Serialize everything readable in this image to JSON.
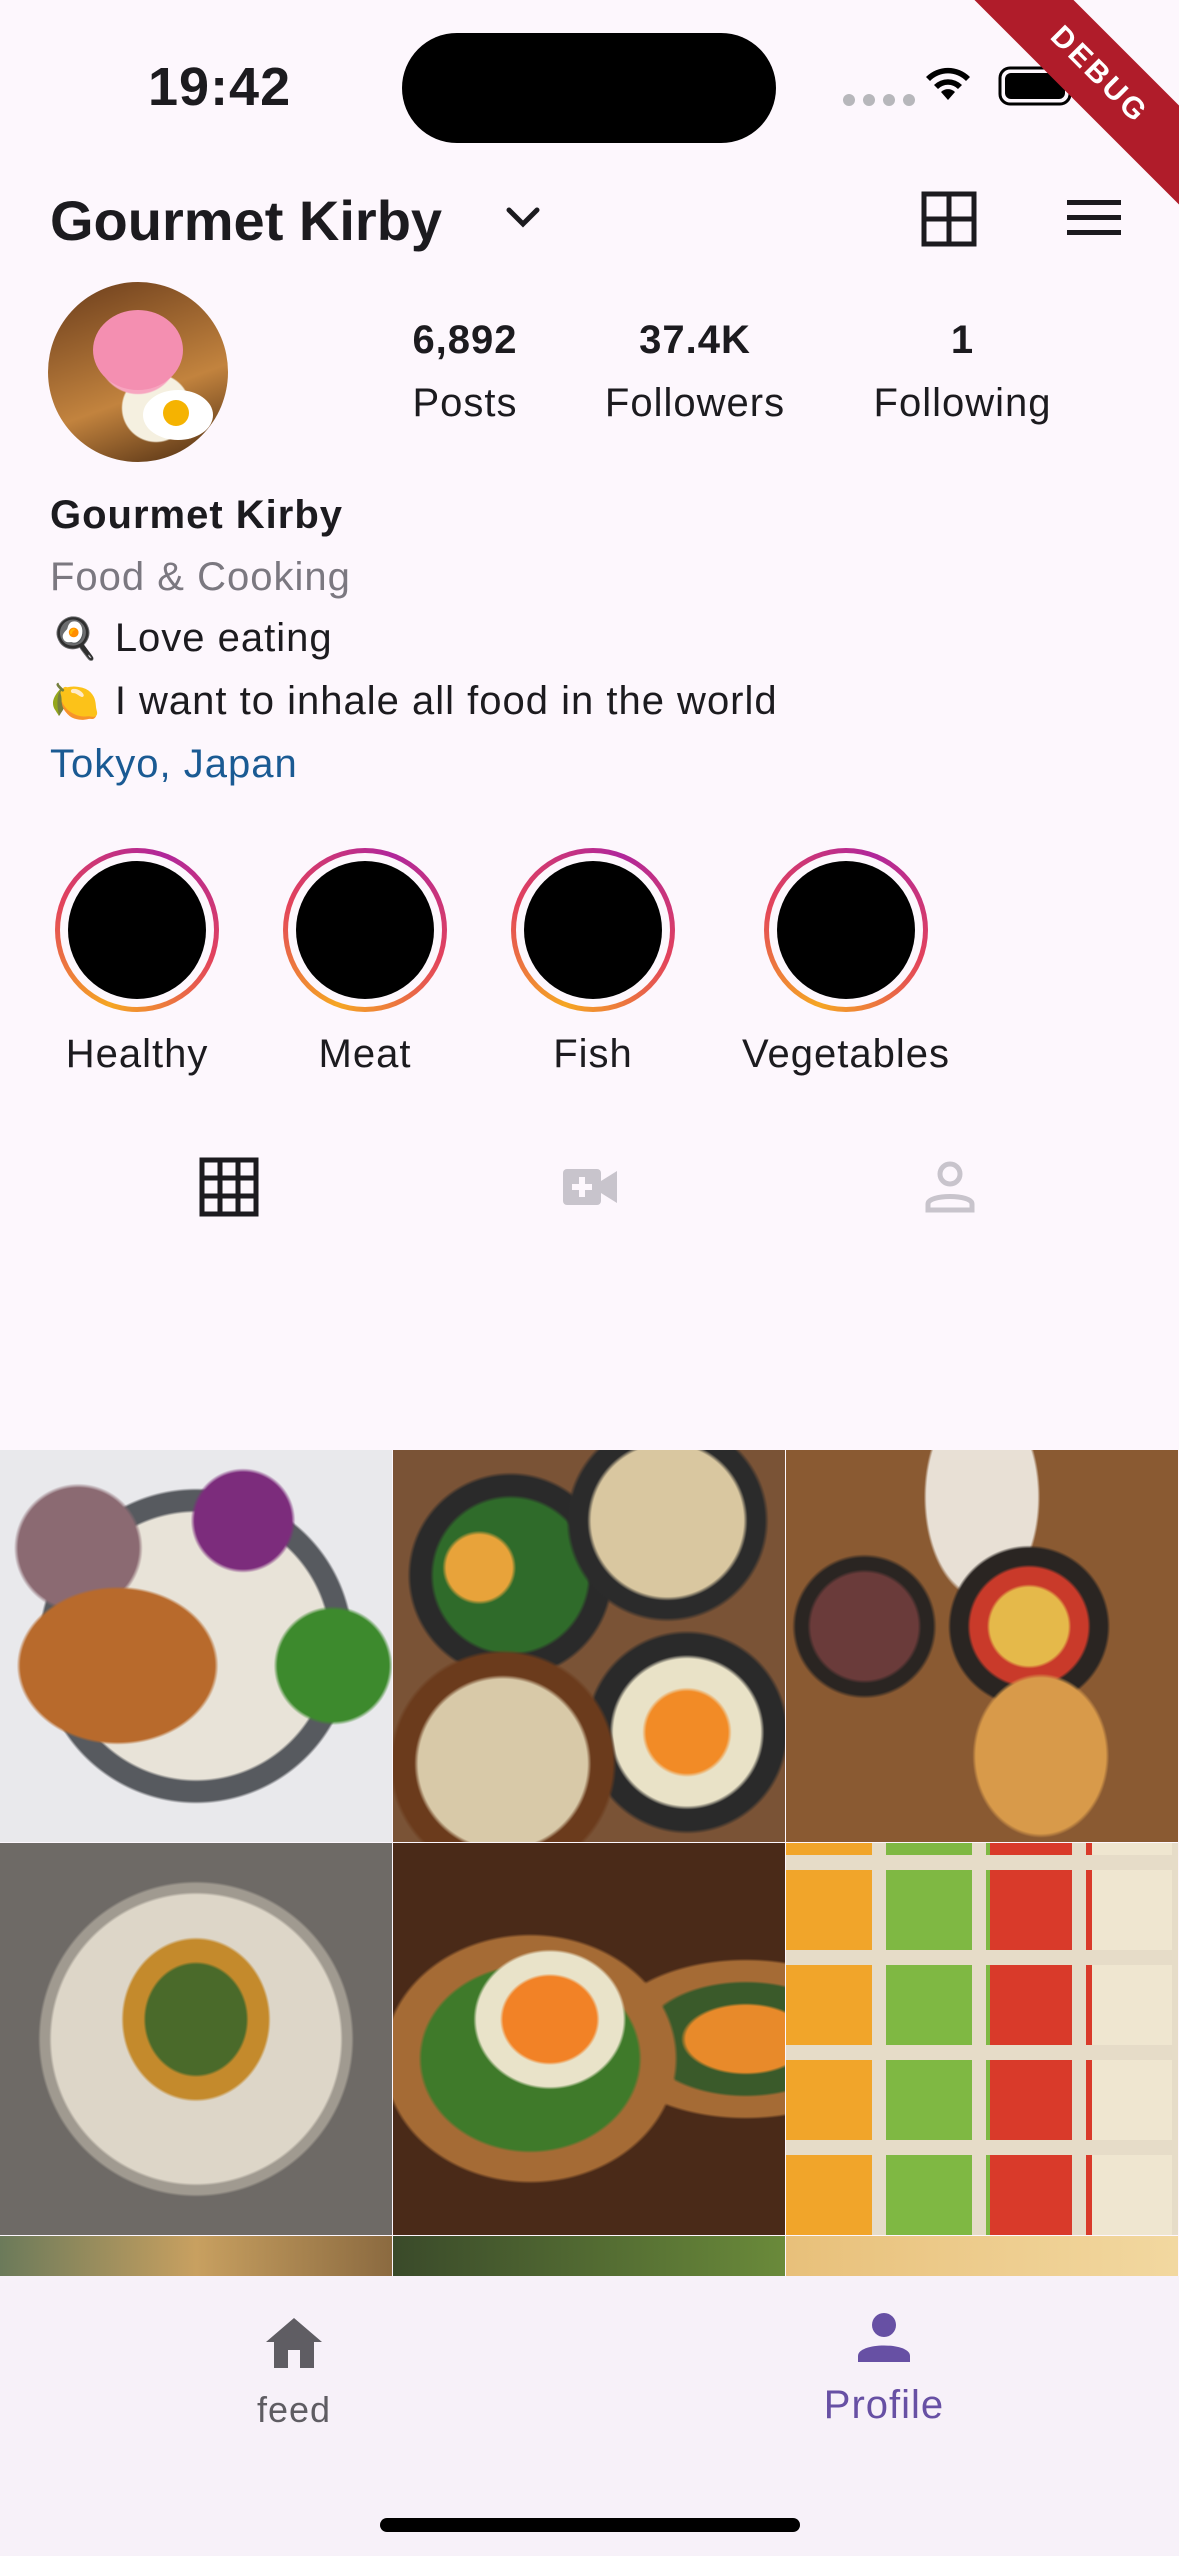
{
  "status_bar": {
    "time": "19:42"
  },
  "debug_banner": "DEBUG",
  "header": {
    "username": "Gourmet Kirby"
  },
  "profile": {
    "stats": [
      {
        "value": "6,892",
        "label": "Posts"
      },
      {
        "value": "37.4K",
        "label": "Followers"
      },
      {
        "value": "1",
        "label": "Following"
      }
    ],
    "name": "Gourmet Kirby",
    "category": "Food & Cooking",
    "bio_lines": [
      {
        "emoji": "🍳",
        "text": "Love eating"
      },
      {
        "emoji": "🍋",
        "text": "I want to inhale all food in the world"
      }
    ],
    "location": "Tokyo, Japan"
  },
  "highlights": [
    {
      "label": "Healthy"
    },
    {
      "label": "Meat"
    },
    {
      "label": "Fish"
    },
    {
      "label": "Vegetables"
    }
  ],
  "tabs": [
    {
      "icon": "grid-icon",
      "active": true
    },
    {
      "icon": "video-add-icon",
      "active": false
    },
    {
      "icon": "tagged-person-icon",
      "active": false
    }
  ],
  "bottom_nav": {
    "items": [
      {
        "label": "feed",
        "icon": "home-icon",
        "active": false
      },
      {
        "label": "Profile",
        "icon": "person-icon",
        "active": true
      }
    ]
  },
  "colors": {
    "accent": "#6750a4",
    "location_link": "#1a5a93",
    "inactive": "#5f5d63",
    "background": "#fdf7fd"
  }
}
